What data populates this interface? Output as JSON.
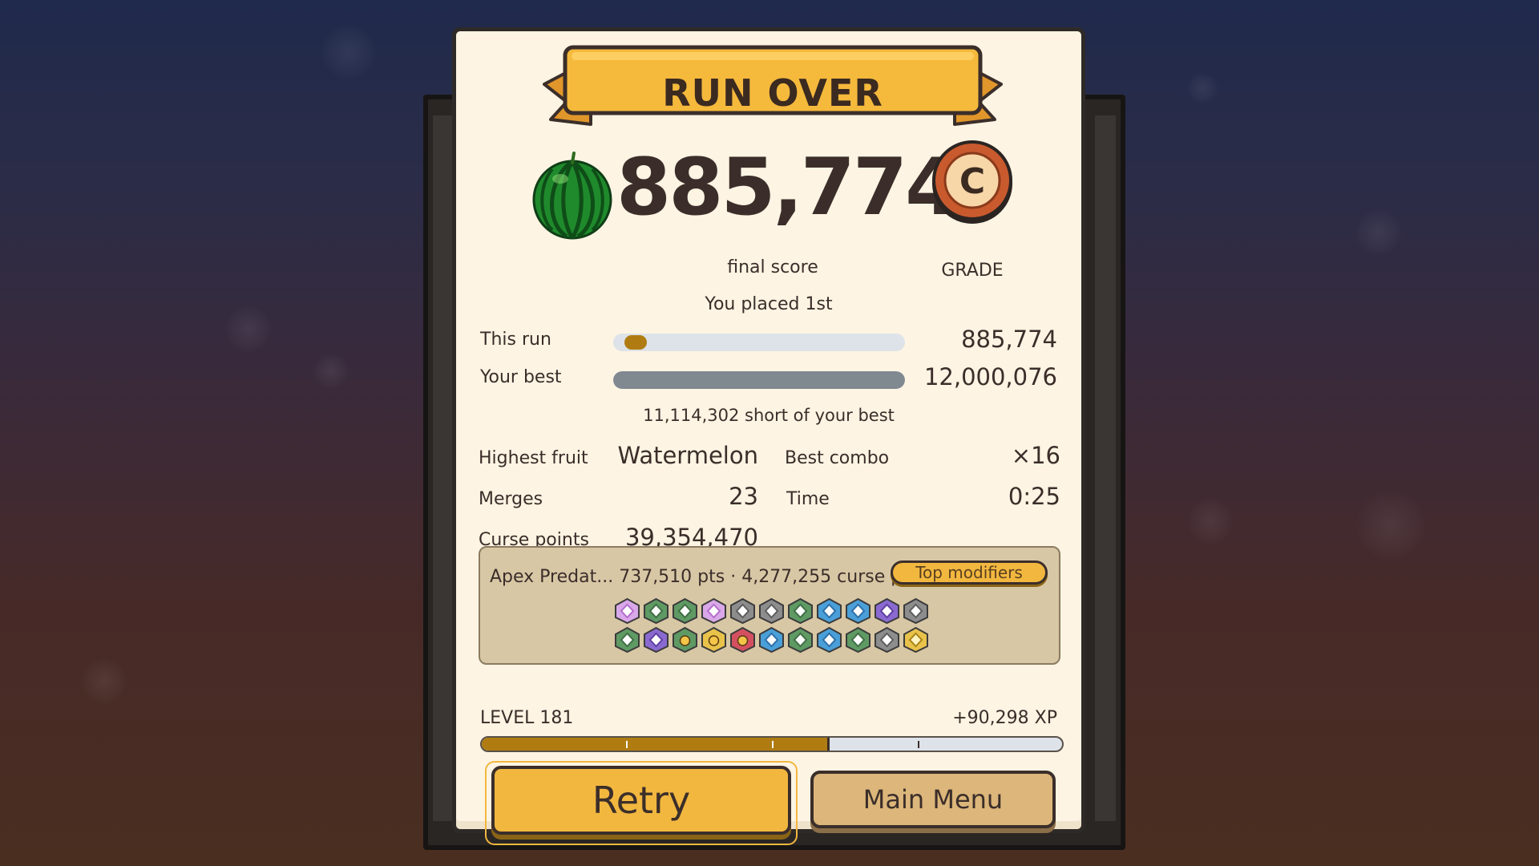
{
  "title": "RUN OVER",
  "fruit_icon": "watermelon-icon",
  "score": "885,774",
  "score_label": "final score",
  "grade": "C",
  "grade_label": "GRADE",
  "placement": "You placed 1st",
  "comparison": {
    "this_run_label": "This run",
    "this_run_value": "885,774",
    "best_label": "Your best",
    "best_value": "12,000,076",
    "this_run_fraction": 0.074,
    "short_note": "11,114,302 short of your best"
  },
  "stats": {
    "highest_fruit_label": "Highest fruit",
    "highest_fruit_value": "Watermelon",
    "best_combo_label": "Best combo",
    "best_combo_value": "×16",
    "merges_label": "Merges",
    "merges_value": "23",
    "time_label": "Time",
    "time_value": "0:25",
    "curse_points_label": "Curse points",
    "curse_points_value": "39,354,470"
  },
  "modifiers": {
    "summary": "Apex Predat... 737,510 pts · 4,277,255 curse pts",
    "top_modifiers_label": "Top modifiers",
    "row1": [
      "pink",
      "green",
      "green",
      "pink",
      "gray",
      "gray",
      "green",
      "blue",
      "blue",
      "purple",
      "gray"
    ],
    "row2": [
      "green",
      "purple",
      "green-item",
      "gold-item",
      "red-item",
      "blue",
      "green",
      "blue",
      "green",
      "gray",
      "gold"
    ]
  },
  "level": {
    "label": "LEVEL 181",
    "xp_gain": "+90,298 XP",
    "progress": 0.6
  },
  "buttons": {
    "retry": "Retry",
    "main_menu": "Main Menu"
  },
  "colors": {
    "accent": "#f2b73f",
    "panel": "#fdf4e3",
    "text": "#3b2e2a",
    "grade": "#c85a2e",
    "progress": "#b07c12"
  }
}
